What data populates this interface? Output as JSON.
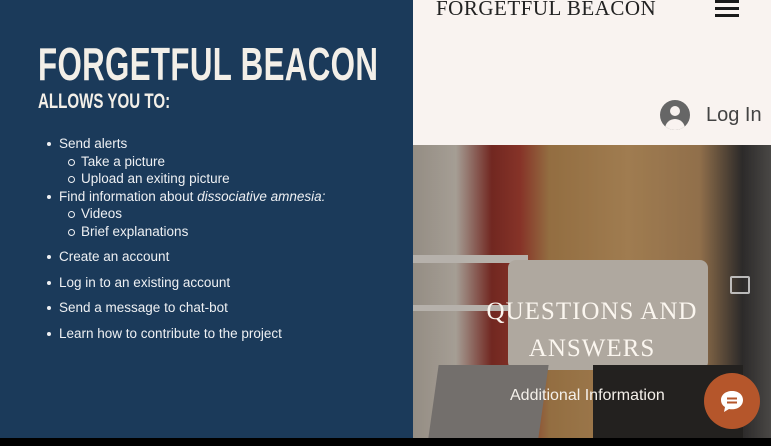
{
  "slide": {
    "title": "FORGETFUL BEACON",
    "subtitle": "ALLOWS YOU TO:",
    "items": [
      {
        "label": "Send alerts"
      },
      {
        "label": "Take a picture"
      },
      {
        "label": "Upload an exiting picture"
      },
      {
        "label": "Find information about ",
        "emphasis": "dissociative amnesia:"
      },
      {
        "label": "Videos"
      },
      {
        "label": "Brief explanations"
      },
      {
        "label": "Create an account"
      },
      {
        "label": "Log in to an existing account"
      },
      {
        "label": "Send a message to chat-bot"
      },
      {
        "label": "Learn how to contribute to the project"
      }
    ]
  },
  "site": {
    "brand": "FORGETFUL BEACON",
    "login_label": "Log In",
    "hero_title_line1": "QUESTIONS AND",
    "hero_title_line2": "ANSWERS",
    "hero_link": "Additional Information",
    "accent_color": "#b5562b"
  }
}
